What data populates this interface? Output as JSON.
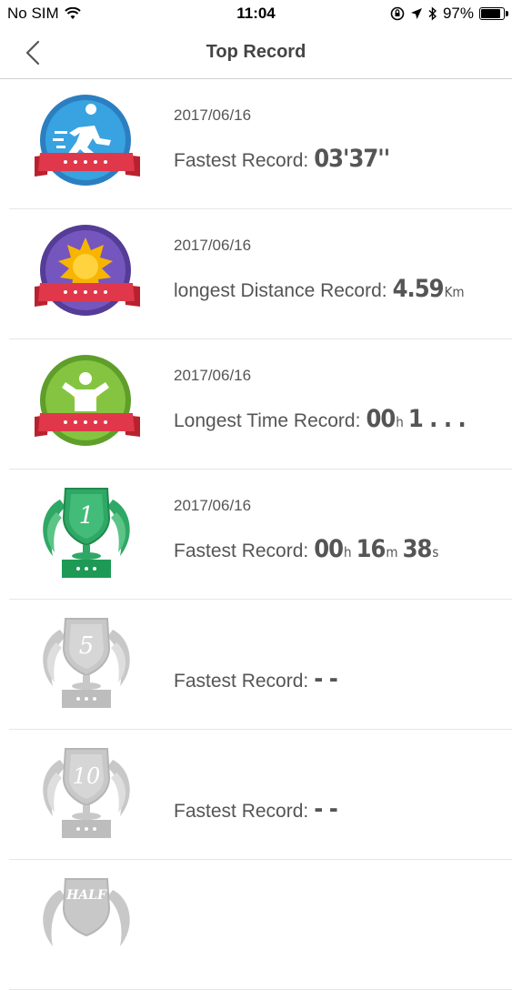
{
  "status": {
    "carrier": "No SIM",
    "time": "11:04",
    "battery": "97%",
    "battery_level": 0.97
  },
  "nav": {
    "title": "Top Record"
  },
  "records": [
    {
      "date": "2017/06/16",
      "label": "Fastest Record:",
      "parts": [
        {
          "v": "03'37''",
          "u": ""
        }
      ],
      "badge": "run-medal-icon"
    },
    {
      "date": "2017/06/16",
      "label": "longest Distance Record:",
      "parts": [
        {
          "v": "4.59",
          "u": "Km"
        }
      ],
      "badge": "sun-medal-icon"
    },
    {
      "date": "2017/06/16",
      "label": "Longest Time Record:",
      "parts": [
        {
          "v": "00",
          "u": "h"
        },
        {
          "v": "1 . . .",
          "u": ""
        }
      ],
      "badge": "person-medal-icon"
    },
    {
      "date": "2017/06/16",
      "label": "Fastest Record:",
      "parts": [
        {
          "v": "00",
          "u": "h"
        },
        {
          "v": "16",
          "u": "m"
        },
        {
          "v": "38",
          "u": "s"
        }
      ],
      "badge": "trophy-1km-icon",
      "badge_text": "1"
    },
    {
      "date": "",
      "label": "Fastest Record:",
      "parts": [
        {
          "v": "- -",
          "u": ""
        }
      ],
      "badge": "trophy-5km-icon",
      "badge_text": "5"
    },
    {
      "date": "",
      "label": "Fastest Record:",
      "parts": [
        {
          "v": "- -",
          "u": ""
        }
      ],
      "badge": "trophy-10km-icon",
      "badge_text": "10"
    },
    {
      "date": "",
      "label": "",
      "parts": [],
      "badge": "trophy-half-icon",
      "badge_text": "HALF"
    }
  ],
  "colors": {
    "blue": "#2f8fcf",
    "purple": "#6c4fb0",
    "green": "#7ab93a",
    "trophy_green": "#2fa865",
    "ribbon": "#e0384a",
    "gray_trophy": "#c8c8c8"
  }
}
